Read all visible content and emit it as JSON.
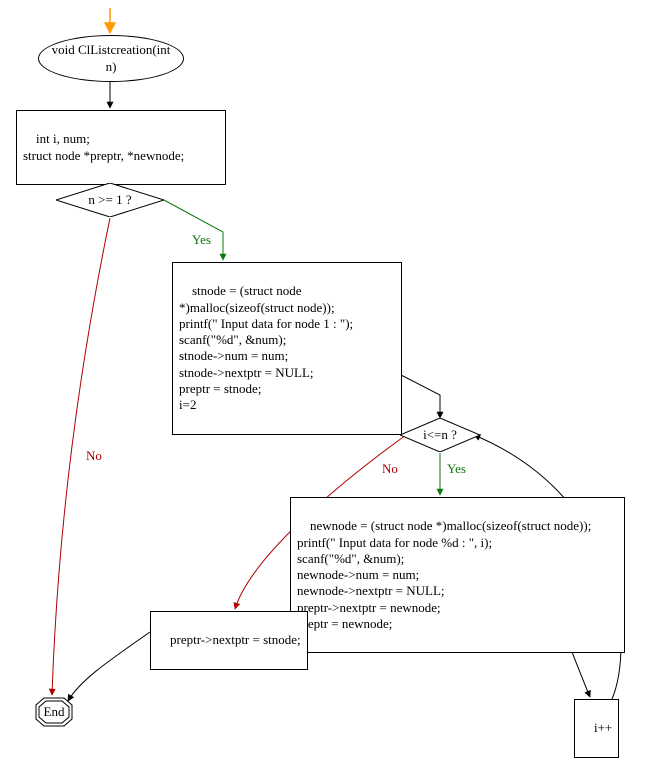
{
  "chart_data": {
    "type": "flowchart",
    "nodes": [
      {
        "id": "start",
        "kind": "start-arrow"
      },
      {
        "id": "func",
        "kind": "terminator",
        "text": "void ClListcreation(int\nn)"
      },
      {
        "id": "decls",
        "kind": "process",
        "text": "int i, num;\nstruct node *preptr, *newnode;"
      },
      {
        "id": "cond1",
        "kind": "decision",
        "text": "n >= 1 ?"
      },
      {
        "id": "init",
        "kind": "process",
        "text": "stnode = (struct node\n*)malloc(sizeof(struct node));\nprintf(\" Input data for node 1 : \");\nscanf(\"%d\", &num);\nstnode->num = num;\nstnode->nextptr = NULL;\npreptr = stnode;\ni=2"
      },
      {
        "id": "cond2",
        "kind": "decision",
        "text": "i<=n ?"
      },
      {
        "id": "loop",
        "kind": "process",
        "text": "newnode = (struct node *)malloc(sizeof(struct node));\nprintf(\" Input data for node %d : \", i);\nscanf(\"%d\", &num);\nnewnode->num = num;\nnewnode->nextptr = NULL;\npreptr->nextptr = newnode;\npreptr = newnode;"
      },
      {
        "id": "close",
        "kind": "process",
        "text": "preptr->nextptr = stnode;"
      },
      {
        "id": "inc",
        "kind": "process",
        "text": "i++"
      },
      {
        "id": "end",
        "kind": "terminator",
        "text": "End"
      }
    ],
    "edges": [
      {
        "from": "start",
        "to": "func"
      },
      {
        "from": "func",
        "to": "decls"
      },
      {
        "from": "decls",
        "to": "cond1"
      },
      {
        "from": "cond1",
        "to": "init",
        "label": "Yes"
      },
      {
        "from": "cond1",
        "to": "end",
        "label": "No"
      },
      {
        "from": "init",
        "to": "cond2"
      },
      {
        "from": "cond2",
        "to": "loop",
        "label": "Yes"
      },
      {
        "from": "cond2",
        "to": "close",
        "label": "No"
      },
      {
        "from": "loop",
        "to": "inc"
      },
      {
        "from": "inc",
        "to": "cond2"
      },
      {
        "from": "close",
        "to": "end"
      }
    ]
  },
  "labels": {
    "yes": "Yes",
    "no": "No"
  },
  "nodes": {
    "func": "void ClListcreation(int\nn)",
    "decls": "int i, num;\nstruct node *preptr, *newnode;",
    "cond1": "n >= 1 ?",
    "init": "stnode = (struct node\n*)malloc(sizeof(struct node));\nprintf(\" Input data for node 1 : \");\nscanf(\"%d\", &num);\nstnode->num = num;\nstnode->nextptr = NULL;\npreptr = stnode;\ni=2",
    "cond2": "i<=n ?",
    "loop": "newnode = (struct node *)malloc(sizeof(struct node));\nprintf(\" Input data for node %d : \", i);\nscanf(\"%d\", &num);\nnewnode->num = num;\nnewnode->nextptr = NULL;\npreptr->nextptr = newnode;\npreptr = newnode;",
    "close": "preptr->nextptr = stnode;",
    "inc": "i++",
    "end": "End"
  }
}
